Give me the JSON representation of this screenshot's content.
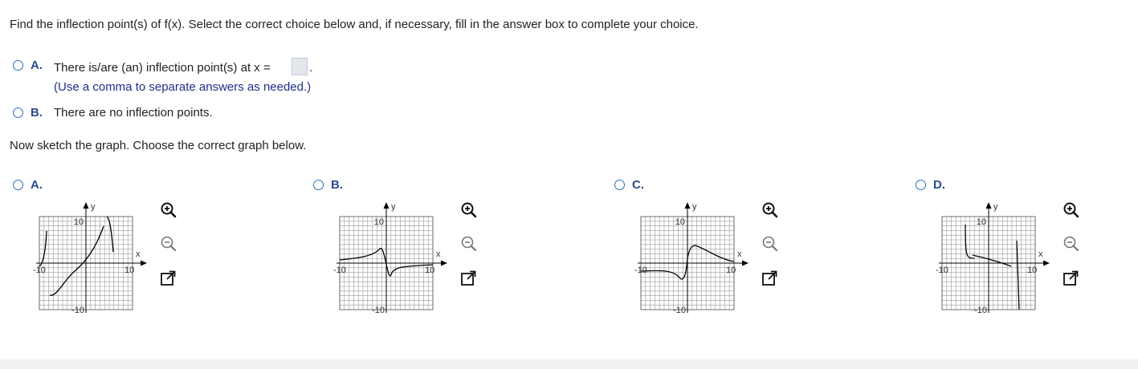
{
  "part1": {
    "prompt": "Find the inflection point(s) of f(x). Select the correct choice below and, if necessary, fill in the answer box to complete your choice.",
    "choices": [
      {
        "letter": "A.",
        "text": "There is/are (an) inflection point(s) at x =",
        "hint": "(Use a comma to separate answers as needed.)",
        "answer_value": ""
      },
      {
        "letter": "B.",
        "text": "There are no inflection points."
      }
    ]
  },
  "part2": {
    "prompt": "Now sketch the graph. Choose the correct graph below.",
    "graphs": [
      {
        "letter": "A.",
        "x_min": -10,
        "x_max": 10,
        "y_min": -10,
        "y_max": 10,
        "x_axis_label": "x",
        "y_axis_label": "y",
        "tick_labels": {
          "x_neg": "-10",
          "x_pos": "10",
          "y_pos": "10",
          "y_neg": "-10"
        }
      },
      {
        "letter": "B.",
        "x_min": -10,
        "x_max": 10,
        "y_min": -10,
        "y_max": 10,
        "x_axis_label": "x",
        "y_axis_label": "y",
        "tick_labels": {
          "x_neg": "-10",
          "x_pos": "10",
          "y_pos": "10",
          "y_neg": "-10"
        }
      },
      {
        "letter": "C.",
        "x_min": -10,
        "x_max": 10,
        "y_min": -10,
        "y_max": 10,
        "x_axis_label": "x",
        "y_axis_label": "y",
        "tick_labels": {
          "x_neg": "-10",
          "x_pos": "10",
          "y_pos": "10",
          "y_neg": "-10"
        }
      },
      {
        "letter": "D.",
        "x_min": -10,
        "x_max": 10,
        "y_min": -10,
        "y_max": 10,
        "x_axis_label": "x",
        "y_axis_label": "y",
        "tick_labels": {
          "x_neg": "-10",
          "x_pos": "10",
          "y_pos": "10",
          "y_neg": "-10"
        }
      }
    ],
    "tools": [
      "zoom-in-icon",
      "zoom-out-icon",
      "expand-icon"
    ]
  },
  "colors": {
    "radio": "#2a6ebb",
    "letter": "#2a4b8d",
    "hint": "#1f2e8a",
    "grid": "#9a9a9a",
    "curve": "#000000"
  }
}
